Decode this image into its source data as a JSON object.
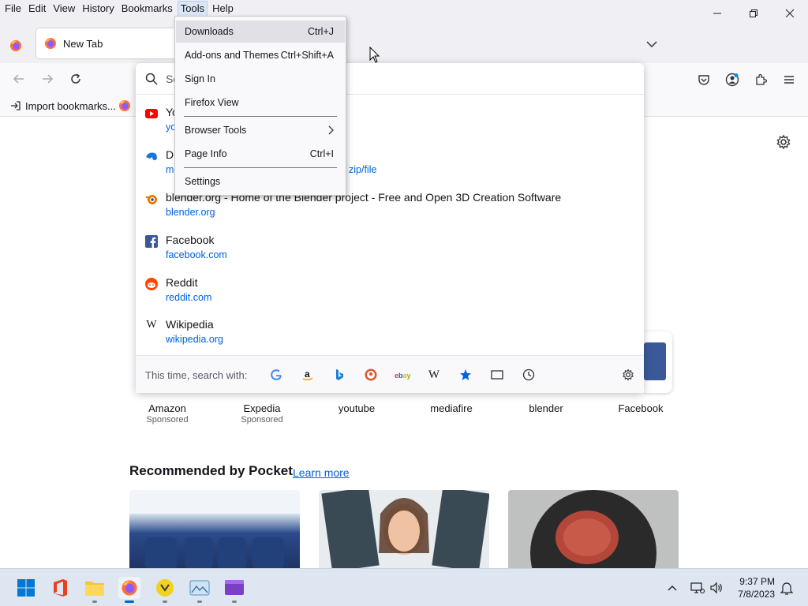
{
  "menubar": {
    "items": [
      "File",
      "Edit",
      "View",
      "History",
      "Bookmarks",
      "Tools",
      "Help"
    ],
    "active": "Tools"
  },
  "tab": {
    "title": "New Tab"
  },
  "bookmarks": {
    "import_label": "Import bookmarks..."
  },
  "urlbar": {
    "placeholder_visible": "Se"
  },
  "suggestions": [
    {
      "title": "Yo",
      "url": "yo",
      "icon": "youtube-icon"
    },
    {
      "title": "D",
      "url": "m",
      "url_tail": "zip/file",
      "icon": "downloads-site-icon"
    },
    {
      "title": "blender.org - Home of the Blender project - Free and Open 3D Creation Software",
      "url": "blender.org",
      "icon": "blender-icon"
    },
    {
      "title": "Facebook",
      "url": "facebook.com",
      "icon": "facebook-icon"
    },
    {
      "title": "Reddit",
      "url": "reddit.com",
      "icon": "reddit-icon"
    },
    {
      "title": "Wikipedia",
      "url": "wikipedia.org",
      "icon": "wikipedia-icon"
    }
  ],
  "search_with": {
    "label": "This time, search with:",
    "engines": [
      "Google",
      "Amazon",
      "Bing",
      "DuckDuckGo",
      "eBay",
      "Wikipedia",
      "Bookmarks",
      "Tabs",
      "History"
    ]
  },
  "tools_menu": {
    "items": [
      {
        "label": "Downloads",
        "accel": "Ctrl+J",
        "highlighted": true
      },
      {
        "label": "Add-ons and Themes",
        "accel": "Ctrl+Shift+A"
      },
      {
        "label": "Sign In",
        "accel": ""
      },
      {
        "label": "Firefox View",
        "accel": ""
      },
      {
        "label": "Browser Tools",
        "accel": "",
        "submenu": true
      },
      {
        "label": "Page Info",
        "accel": "Ctrl+I"
      },
      {
        "label": "Settings",
        "accel": ""
      }
    ]
  },
  "top_sites": [
    {
      "label": "Amazon",
      "sub": "Sponsored"
    },
    {
      "label": "Expedia",
      "sub": "Sponsored"
    },
    {
      "label": "youtube",
      "sub": ""
    },
    {
      "label": "mediafire",
      "sub": ""
    },
    {
      "label": "blender",
      "sub": ""
    },
    {
      "label": "Facebook",
      "sub": ""
    }
  ],
  "pocket": {
    "title": "Recommended by Pocket",
    "learn_more": "Learn more"
  },
  "taskbar": {
    "time": "9:37 PM",
    "date": "7/8/2023"
  },
  "colors": {
    "accent": "#0061e0",
    "menu_bg": "#f0f0f4",
    "taskbar_bg": "#dde6f1"
  }
}
